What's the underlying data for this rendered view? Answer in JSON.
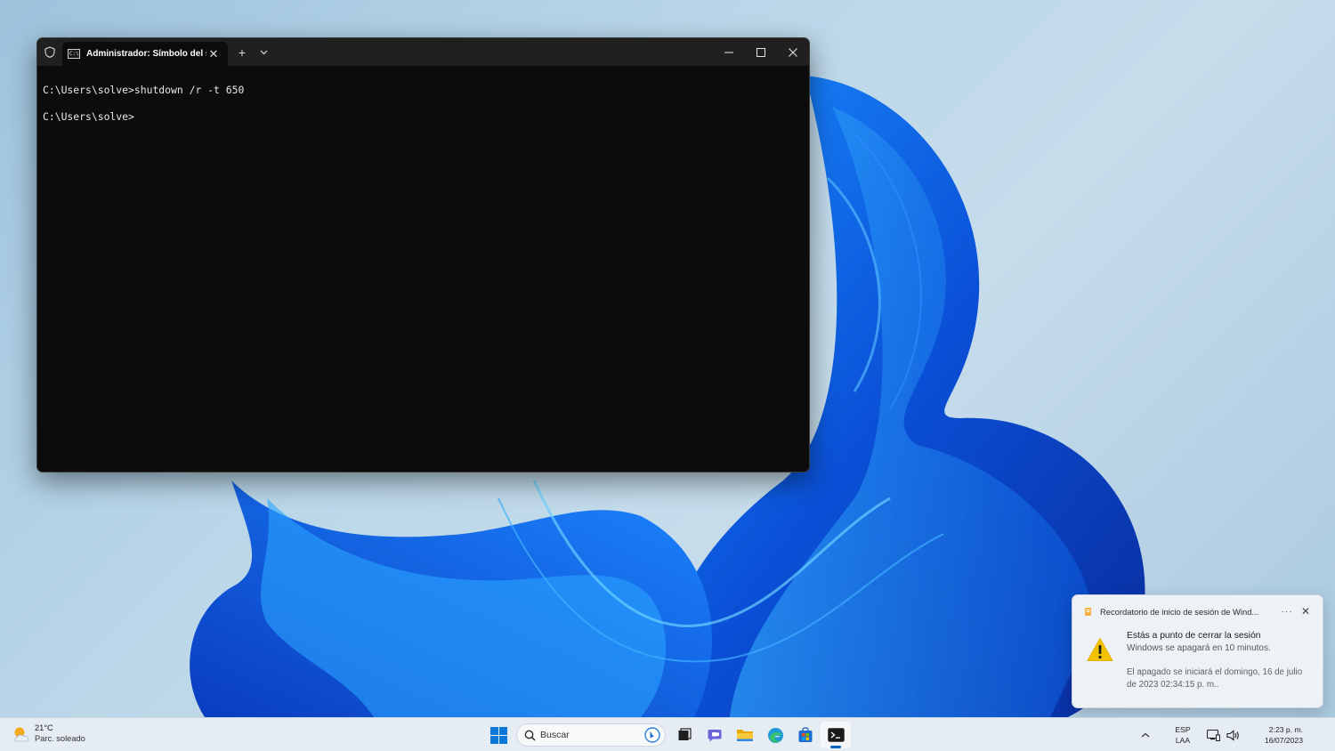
{
  "terminal": {
    "tab_title": "Administrador: Símbolo del si",
    "new_tab_label": "+",
    "lines": [
      "C:\\Users\\solve>shutdown /r -t 650",
      "C:\\Users\\solve>"
    ]
  },
  "toast": {
    "app_name": "Recordatorio de inicio de sesión de Wind...",
    "more_label": "···",
    "title": "Estás a punto de cerrar la sesión",
    "subtitle": "Windows se apagará en 10 minutos.",
    "detail": "El apagado se iniciará el domingo, 16 de julio de 2023 02:34:15 p. m.."
  },
  "taskbar": {
    "weather_temp": "21°C",
    "weather_desc": "Parc. soleado",
    "search_placeholder": "Buscar",
    "apps": [
      "bing-icon",
      "task-view-icon",
      "teams-chat-icon",
      "file-explorer-icon",
      "edge-icon",
      "store-icon",
      "terminal-icon"
    ],
    "lang_top": "ESP",
    "lang_bottom": "LAA",
    "time": "2:23 p. m.",
    "date": "16/07/2023"
  },
  "colors": {
    "accent": "#0067c0",
    "terminal_bg": "#0c0c0c",
    "warning": "#f2c200"
  }
}
